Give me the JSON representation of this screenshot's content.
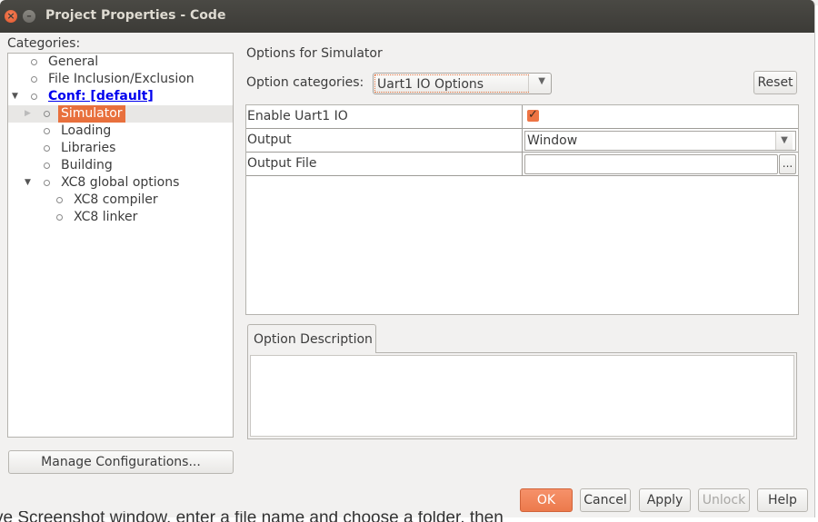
{
  "window": {
    "title": "Project Properties - Code"
  },
  "background_text": "ve Screenshot window, enter a file name and choose a folder, then",
  "categories": {
    "label": "Categories:",
    "items": [
      {
        "label": "General"
      },
      {
        "label": "File Inclusion/Exclusion"
      },
      {
        "label": "Conf: [default]"
      },
      {
        "label": "Simulator"
      },
      {
        "label": "Loading"
      },
      {
        "label": "Libraries"
      },
      {
        "label": "Building"
      },
      {
        "label": "XC8 global options"
      },
      {
        "label": "XC8 compiler"
      },
      {
        "label": "XC8 linker"
      }
    ],
    "selected": "Simulator"
  },
  "manage_button": "Manage Configurations...",
  "options": {
    "title": "Options for Simulator",
    "category_label": "Option categories:",
    "category_value": "Uart1 IO Options",
    "reset_button": "Reset",
    "rows": [
      {
        "key": "Enable Uart1 IO",
        "checked": true
      },
      {
        "key": "Output",
        "value": "Window"
      },
      {
        "key": "Output File",
        "value": "",
        "button": "..."
      }
    ]
  },
  "description": {
    "tab_label": "Option Description",
    "text": ""
  },
  "buttons": {
    "ok": "OK",
    "cancel": "Cancel",
    "apply": "Apply",
    "unlock": "Unlock",
    "help": "Help"
  },
  "colors": {
    "accent": "#e8703d",
    "link": "#0000ee",
    "titlebar": "#3c3b37"
  }
}
